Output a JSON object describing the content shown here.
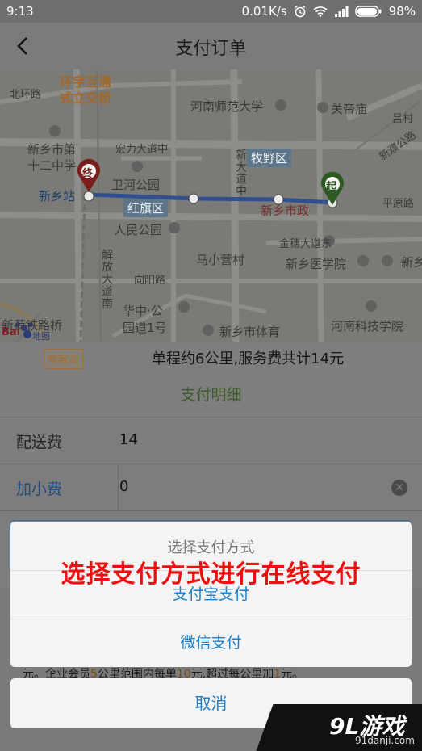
{
  "status_bar": {
    "time": "9:13",
    "network_speed": "0.01K/s",
    "battery": "98%",
    "icons": [
      "alarm-icon",
      "wifi-icon",
      "signal-icon",
      "battery-icon"
    ]
  },
  "header": {
    "title": "支付订单",
    "back_icon": "chevron-left-icon"
  },
  "map": {
    "labels": {
      "huanyu": "环宇互通",
      "shili": "式立交桥",
      "beihuan": "北环路",
      "henan_normal": "河南师范大学",
      "guandimiao": "关帝庙",
      "lvcun": "吕村",
      "xinxiang_no12": "新乡市第",
      "xinxiang_no12_b": "十二中学",
      "honghe": "宏力大道中",
      "xinpu": "新濮公路",
      "weihe_park": "卫河公园",
      "xinxiang_station": "新乡站",
      "hongqi": "红旗区",
      "muye": "牧野区",
      "xinda": "新大道中",
      "xinxiang_gov": "新乡市政",
      "pingyuan": "平原路",
      "renmin_park": "人民公园",
      "jinsui": "金穗大道东",
      "maxiaoying": "马小营村",
      "medical": "新乡医学院",
      "xinxiang_right": "新乡",
      "jiefang": "解放大道南",
      "xiangyang": "向阳路",
      "huazhong": "华中·公",
      "huazhong2": "园道1号",
      "tiyu": "新乡市体育",
      "hnkj": "河南科技学院",
      "railbridge": "新荷铁路桥",
      "baidu": "Bai",
      "baidu_map": "地图",
      "start_marker": "起",
      "end_marker": "终"
    }
  },
  "order": {
    "help_badge": "帮我买",
    "summary": "单程约6公里,服务费共计14元",
    "detail_link": "支付明细"
  },
  "fees": {
    "delivery_label": "配送费",
    "delivery_value": "14",
    "tip_label": "加小费",
    "tip_value": "0"
  },
  "behind_text": {
    "prefix": "元。企业会员",
    "n1": "5",
    "mid1": "公里范围内每单",
    "n2": "10",
    "mid2": "元,超过每公里加",
    "n3": "1",
    "suffix": "元。"
  },
  "payment_sheet": {
    "title": "选择支付方式",
    "overlay_caption": "选择支付方式进行在线支付",
    "alipay": "支付宝支付",
    "wechat": "微信支付",
    "cancel": "取消"
  },
  "watermark": {
    "logo": "9L游戏",
    "site": "91danji.com"
  }
}
